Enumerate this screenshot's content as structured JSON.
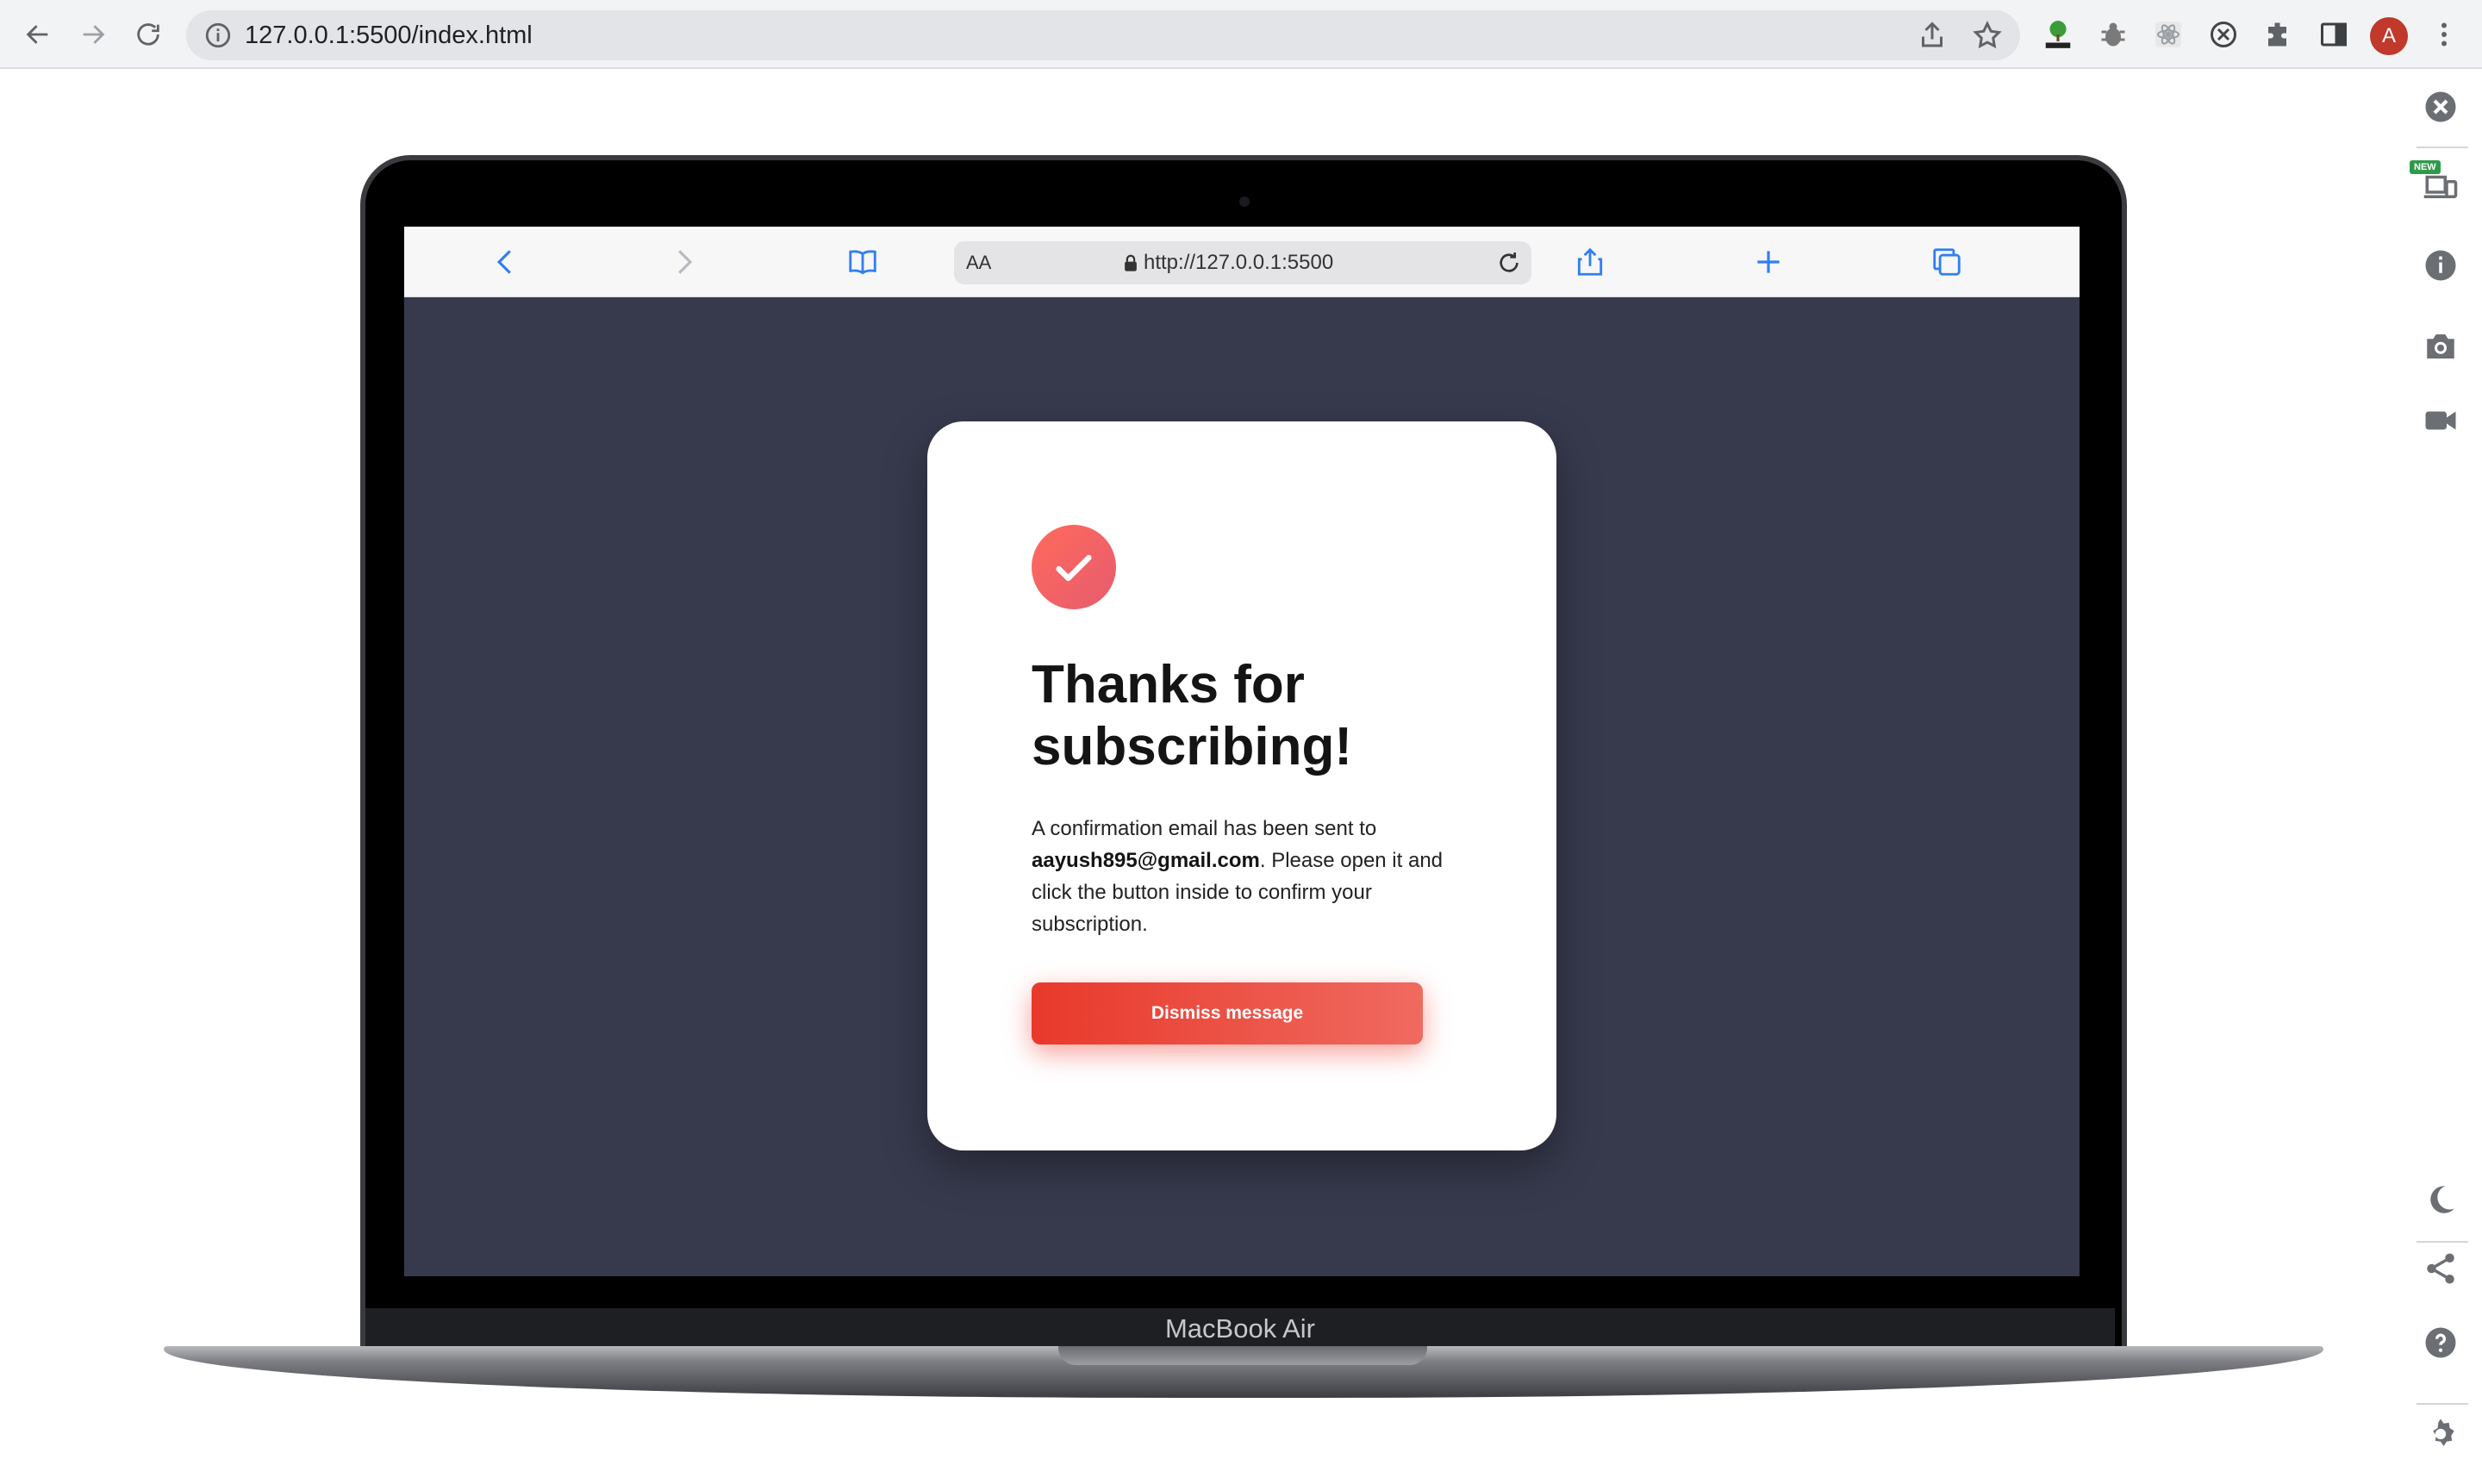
{
  "browser": {
    "url": "127.0.0.1:5500/index.html",
    "avatar_initial": "A",
    "extensions": [
      "html-tree-icon",
      "bug-icon",
      "react-icon",
      "blocked-script-icon",
      "puzzle-icon",
      "side-panel-icon"
    ]
  },
  "side_panel": {
    "new_badge": "NEW",
    "items": [
      "close-icon",
      "responsive-devices-icon",
      "info-icon",
      "camera-icon",
      "video-icon",
      "moon-icon",
      "share-icon",
      "help-icon",
      "settings-icon"
    ]
  },
  "device": {
    "label": "MacBook Air"
  },
  "safari": {
    "aa_label": "AA",
    "url": "http://127.0.0.1:5500"
  },
  "card": {
    "title": "Thanks for subscribing!",
    "body_prefix": "A confirmation email has been sent to ",
    "email": "aayush895@gmail.com",
    "body_suffix": ". Please open it and click the button inside to confirm your subscription.",
    "button_label": "Dismiss message"
  },
  "colors": {
    "screen_bg": "#373a4d",
    "accent": "#e8392b",
    "accent_light": "#f06a60",
    "safari_blue": "#2f7ff5"
  }
}
